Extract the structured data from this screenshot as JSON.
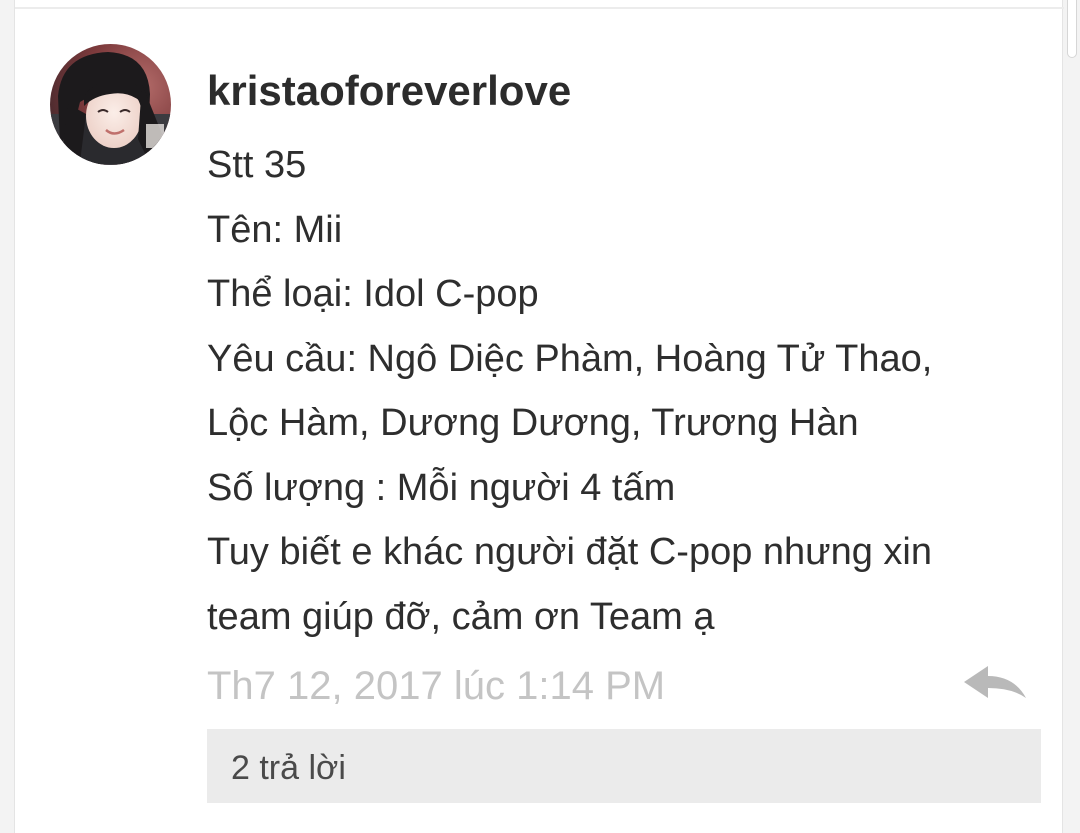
{
  "comment": {
    "author": "kristaoforeverlove",
    "avatar_icon": "profile-photo",
    "body_lines": [
      "Stt 35",
      "Tên: Mii",
      "Thể loại: Idol C-pop",
      "Yêu cầu: Ngô Diệc Phàm,  Hoàng Tử Thao,",
      "Lộc Hàm, Dương Dương, Trương Hàn",
      "Số lượng : Mỗi người 4 tấm",
      "Tuy biết e khác người đặt C-pop nhưng xin",
      "team giúp đỡ,  cảm ơn Team ạ"
    ],
    "timestamp": "Th7 12, 2017 lúc 1:14 PM",
    "reply_icon": "reply-arrow-icon",
    "replies_label": "2 trả lời"
  },
  "colors": {
    "username": "#2c2c2c",
    "body_text": "#2e2e2e",
    "timestamp": "#c4c4c4",
    "reply_icon": "#b9b9b9",
    "replies_bar": "#ebebeb",
    "card_background": "#ffffff"
  }
}
